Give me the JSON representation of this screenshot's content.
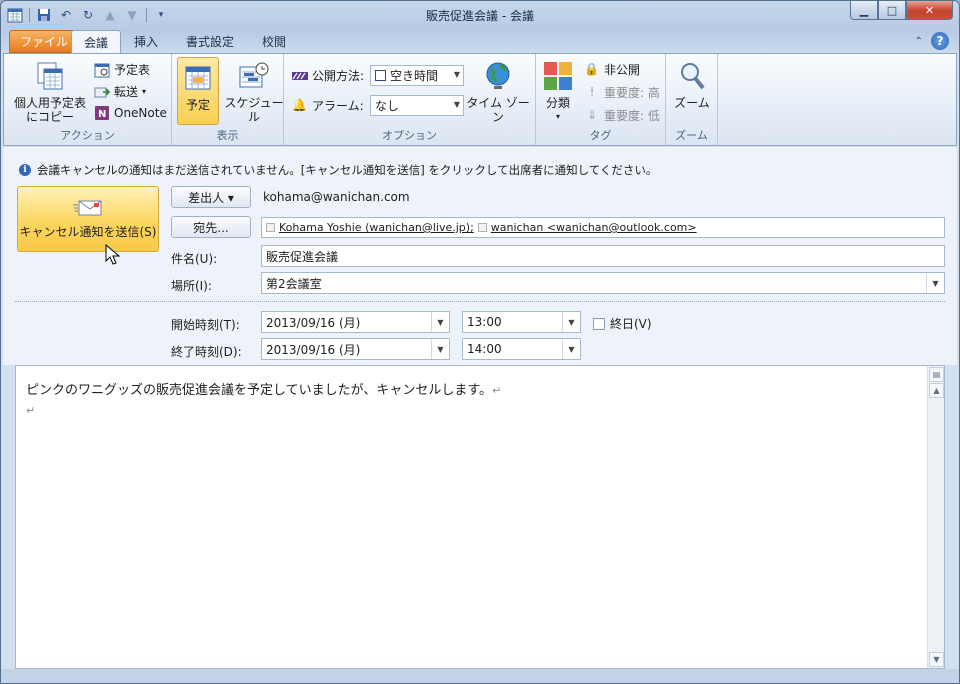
{
  "window": {
    "title": "販売促進会議 - 会議"
  },
  "window_controls": {
    "minimize": "▁",
    "maximize": "□",
    "close": "✕"
  },
  "tabs": [
    {
      "label": "ファイル"
    },
    {
      "label": "会議"
    },
    {
      "label": "挿入"
    },
    {
      "label": "書式設定"
    },
    {
      "label": "校閲"
    }
  ],
  "help": {
    "label": "?"
  },
  "ribbon": {
    "action": {
      "label": "アクション",
      "copy_to_personal": "個人用予定表にコピー",
      "calendar": "予定表",
      "forward": "転送",
      "onenote": "OneNote"
    },
    "show": {
      "label": "表示",
      "appointment": "予定",
      "schedule": "スケジュール"
    },
    "options": {
      "label": "オプション",
      "show_as_label": "公開方法:",
      "show_as_value": "空き時間",
      "reminder_label": "アラーム:",
      "reminder_value": "なし",
      "timezone": "タイム ゾーン"
    },
    "tags": {
      "label": "タグ",
      "categorize": "分類",
      "private": "非公開",
      "high_importance": "重要度: 高",
      "low_importance": "重要度: 低"
    },
    "zoom": {
      "label": "ズーム",
      "zoom": "ズーム"
    }
  },
  "infobar": {
    "icon": "i",
    "message": "会議キャンセルの通知はまだ送信されていません。[キャンセル通知を送信] をクリックして出席者に通知してください。"
  },
  "form": {
    "send_cancel": "キャンセル通知を送信(S)",
    "from_button": "差出人 ▾",
    "from_value": "kohama@wanichan.com",
    "to_button": "宛先...",
    "recipients": [
      "Kohama Yoshie (wanichan@live.jp);",
      "wanichan <wanichan@outlook.com>"
    ],
    "subject_label": "件名(U):",
    "subject_value": "販売促進会議",
    "location_label": "場所(I):",
    "location_value": "第2会議室",
    "start_label": "開始時刻(T):",
    "start_date": "2013/09/16 (月)",
    "start_time": "13:00",
    "end_label": "終了時刻(D):",
    "end_date": "2013/09/16 (月)",
    "end_time": "14:00",
    "all_day_label": "終日(V)",
    "all_day_checked": false
  },
  "body": {
    "line1": "ピンクのワニグッズの販売促進会議を予定していましたが、キャンセルします。",
    "return_mark": "↵"
  },
  "colors": {
    "accent": "#f9cf52",
    "file_tab": "#e87b1a",
    "ribbon_bg": "#e4ecf6"
  }
}
